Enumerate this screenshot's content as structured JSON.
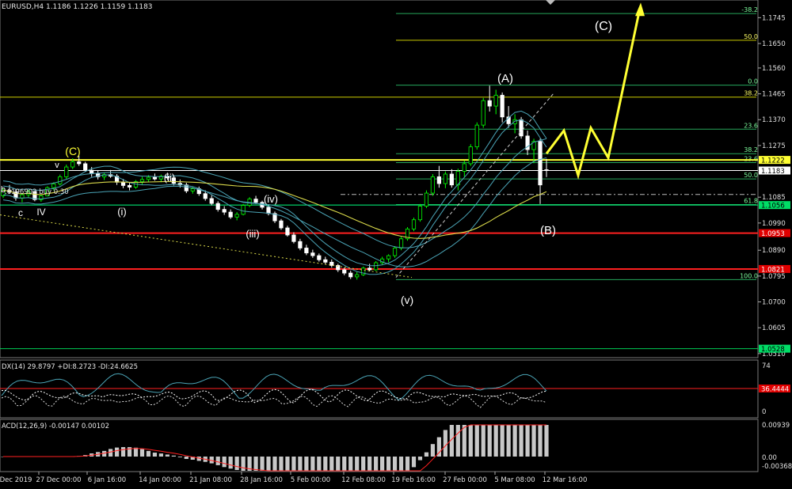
{
  "chart_data": {
    "type": "candlestick",
    "symbol_header": "EURUSD,H4  1.1186 1.1226 1.1159 1.1183",
    "price_axis": {
      "ylim": [
        1.0495,
        1.181
      ],
      "ticks": [
        "1.1745",
        "1.1650",
        "1.1560",
        "1.1465",
        "1.1370",
        "1.1275",
        "1.1085",
        "1.0990",
        "1.0890",
        "1.0795",
        "1.0700",
        "1.0605",
        "1.0510"
      ]
    },
    "time_axis": {
      "labels": [
        "Dec 2019",
        "27 Dec 00:00",
        "6 Jan 16:00",
        "14 Jan 00:00",
        "21 Jan 08:00",
        "28 Jan 16:00",
        "5 Feb 00:00",
        "12 Feb 08:00",
        "19 Feb 16:00",
        "27 Feb 00:00",
        "5 Mar 08:00",
        "12 Mar 16:00"
      ]
    },
    "candles": [
      [
        1.109,
        1.1118,
        1.1082,
        1.111
      ],
      [
        1.111,
        1.113,
        1.1098,
        1.1104
      ],
      [
        1.1104,
        1.1115,
        1.1072,
        1.1082
      ],
      [
        1.1082,
        1.11,
        1.1066,
        1.1094
      ],
      [
        1.1094,
        1.1112,
        1.1085,
        1.1106
      ],
      [
        1.1106,
        1.1108,
        1.107,
        1.1076
      ],
      [
        1.1076,
        1.1095,
        1.1068,
        1.109
      ],
      [
        1.109,
        1.1125,
        1.1088,
        1.112
      ],
      [
        1.112,
        1.114,
        1.111,
        1.1134
      ],
      [
        1.1134,
        1.1168,
        1.1128,
        1.116
      ],
      [
        1.116,
        1.1205,
        1.1152,
        1.1196
      ],
      [
        1.1196,
        1.1228,
        1.1188,
        1.1215
      ],
      [
        1.1215,
        1.1238,
        1.12,
        1.1208
      ],
      [
        1.1208,
        1.1215,
        1.1178,
        1.1184
      ],
      [
        1.1184,
        1.1196,
        1.116,
        1.1172
      ],
      [
        1.1172,
        1.1182,
        1.115,
        1.116
      ],
      [
        1.116,
        1.1176,
        1.1148,
        1.1168
      ],
      [
        1.1168,
        1.1185,
        1.1156,
        1.1162
      ],
      [
        1.1162,
        1.117,
        1.113,
        1.114
      ],
      [
        1.114,
        1.1152,
        1.1118,
        1.1128
      ],
      [
        1.1128,
        1.114,
        1.111,
        1.1122
      ],
      [
        1.1122,
        1.1148,
        1.1116,
        1.1142
      ],
      [
        1.1142,
        1.116,
        1.1132,
        1.115
      ],
      [
        1.115,
        1.1166,
        1.114,
        1.1158
      ],
      [
        1.1158,
        1.1172,
        1.1146,
        1.1152
      ],
      [
        1.1152,
        1.1168,
        1.114,
        1.1162
      ],
      [
        1.1162,
        1.1175,
        1.1148,
        1.1156
      ],
      [
        1.1156,
        1.1162,
        1.1128,
        1.1136
      ],
      [
        1.1136,
        1.115,
        1.112,
        1.113
      ],
      [
        1.113,
        1.1138,
        1.11,
        1.1108
      ],
      [
        1.1108,
        1.1122,
        1.1098,
        1.1116
      ],
      [
        1.1116,
        1.1124,
        1.109,
        1.1098
      ],
      [
        1.1098,
        1.111,
        1.1072,
        1.108
      ],
      [
        1.108,
        1.1092,
        1.1055,
        1.1062
      ],
      [
        1.1062,
        1.107,
        1.1032,
        1.104
      ],
      [
        1.104,
        1.1052,
        1.102,
        1.103
      ],
      [
        1.103,
        1.104,
        1.1005,
        1.1012
      ],
      [
        1.1012,
        1.103,
        1.1,
        1.1022
      ],
      [
        1.1022,
        1.106,
        1.1018,
        1.1055
      ],
      [
        1.1055,
        1.1085,
        1.1048,
        1.1078
      ],
      [
        1.1078,
        1.109,
        1.106,
        1.1066
      ],
      [
        1.1066,
        1.1072,
        1.104,
        1.1048
      ],
      [
        1.1048,
        1.1056,
        1.1018,
        1.1025
      ],
      [
        1.1025,
        1.1032,
        1.099,
        1.0998
      ],
      [
        1.0998,
        1.1005,
        1.0965,
        1.0972
      ],
      [
        1.0972,
        1.098,
        1.094,
        1.0946
      ],
      [
        1.0946,
        1.0956,
        1.0915,
        1.0922
      ],
      [
        1.0922,
        1.0932,
        1.089,
        1.0898
      ],
      [
        1.0898,
        1.091,
        1.0872,
        1.088
      ],
      [
        1.088,
        1.0892,
        1.0862,
        1.087
      ],
      [
        1.087,
        1.0878,
        1.0848,
        1.0855
      ],
      [
        1.0855,
        1.0866,
        1.0838,
        1.0846
      ],
      [
        1.0846,
        1.0856,
        1.0826,
        1.0834
      ],
      [
        1.0834,
        1.084,
        1.081,
        1.0818
      ],
      [
        1.0818,
        1.0826,
        1.0798,
        1.0806
      ],
      [
        1.0806,
        1.0815,
        1.0784,
        1.0792
      ],
      [
        1.0792,
        1.081,
        1.0782,
        1.08
      ],
      [
        1.08,
        1.083,
        1.0795,
        1.0824
      ],
      [
        1.0824,
        1.084,
        1.0812,
        1.0818
      ],
      [
        1.0818,
        1.085,
        1.0814,
        1.0844
      ],
      [
        1.0844,
        1.0866,
        1.0836,
        1.0858
      ],
      [
        1.0858,
        1.0875,
        1.0846,
        1.087
      ],
      [
        1.087,
        1.0905,
        1.0862,
        1.0898
      ],
      [
        1.0898,
        1.094,
        1.089,
        1.0932
      ],
      [
        1.0932,
        1.0975,
        1.0925,
        1.0968
      ],
      [
        1.0968,
        1.101,
        1.096,
        1.1002
      ],
      [
        1.1002,
        1.106,
        1.0995,
        1.1052
      ],
      [
        1.1052,
        1.111,
        1.1045,
        1.11
      ],
      [
        1.11,
        1.117,
        1.109,
        1.116
      ],
      [
        1.116,
        1.12,
        1.112,
        1.1135
      ],
      [
        1.1135,
        1.118,
        1.1118,
        1.117
      ],
      [
        1.117,
        1.1188,
        1.112,
        1.113
      ],
      [
        1.113,
        1.119,
        1.111,
        1.118
      ],
      [
        1.118,
        1.122,
        1.116,
        1.1208
      ],
      [
        1.1208,
        1.128,
        1.12,
        1.127
      ],
      [
        1.127,
        1.136,
        1.126,
        1.135
      ],
      [
        1.135,
        1.145,
        1.134,
        1.144
      ],
      [
        1.144,
        1.1495,
        1.14,
        1.142
      ],
      [
        1.142,
        1.148,
        1.139,
        1.146
      ],
      [
        1.146,
        1.147,
        1.136,
        1.138
      ],
      [
        1.138,
        1.142,
        1.134,
        1.1355
      ],
      [
        1.1355,
        1.139,
        1.132,
        1.137
      ],
      [
        1.137,
        1.138,
        1.13,
        1.131
      ],
      [
        1.131,
        1.133,
        1.124,
        1.126
      ],
      [
        1.126,
        1.13,
        1.121,
        1.129
      ],
      [
        1.129,
        1.13,
        1.106,
        1.113
      ],
      [
        1.1186,
        1.1226,
        1.1159,
        1.1183
      ]
    ],
    "fib_levels": [
      {
        "label": "-38.2",
        "price": 1.176
      },
      {
        "label": "50.0",
        "price": 1.1662
      },
      {
        "label": "0.0",
        "price": 1.1497
      },
      {
        "label": "38.2",
        "price": 1.1453
      },
      {
        "label": "23.6",
        "price": 1.1335
      },
      {
        "label": "38.2",
        "price": 1.1245
      },
      {
        "label": "23.6",
        "price": 1.1212
      },
      {
        "label": "50.0",
        "price": 1.1152
      },
      {
        "label": "61.8",
        "price": 1.1058
      },
      {
        "label": "100.0",
        "price": 1.0782
      }
    ],
    "price_lines": [
      {
        "label": "1.1222",
        "price": 1.1222,
        "color": "#ffff33",
        "badge": "yellow"
      },
      {
        "label": "1.1183",
        "price": 1.1183,
        "color": "#ffffff",
        "badge": "white"
      },
      {
        "label": "1.1056",
        "price": 1.1056,
        "color": "#00ff7f",
        "badge": "green"
      },
      {
        "label": "1.0953",
        "price": 1.0953,
        "color": "#ff2020",
        "badge": "red"
      },
      {
        "label": "1.0821",
        "price": 1.0821,
        "color": "#ff2020",
        "badge": "red"
      },
      {
        "label": "1.0528",
        "price": 1.0528,
        "color": "#00cc55",
        "badge": "green"
      }
    ],
    "wave_labels": [
      {
        "text": "(C)",
        "color": "#ffff33"
      },
      {
        "text": "v",
        "color": "#ffffff"
      },
      {
        "text": "c",
        "color": "#ffffff"
      },
      {
        "text": "IV",
        "color": "#ffffff"
      },
      {
        "text": "(i)",
        "color": "#ffffff"
      },
      {
        "text": "(ii)",
        "color": "#ffffff"
      },
      {
        "text": "(iii)",
        "color": "#ffffff"
      },
      {
        "text": "(iv)",
        "color": "#ffffff"
      },
      {
        "text": "(v)",
        "color": "#ffffff"
      },
      {
        "text": "(A)",
        "color": "#ffffff"
      },
      {
        "text": "(B)",
        "color": "#ffffff"
      },
      {
        "text": "(C)",
        "color": "#ffffff"
      },
      {
        "text": "b",
        "color": "#ffffff"
      }
    ],
    "side_note": ".6196902 buy 0.30",
    "projection_color": "#ffff33",
    "adx": {
      "title": "DX(14) 29.8797 +DI:8.2723 -DI:24.6625",
      "ticks": [
        "74",
        "0"
      ],
      "level_label": "36.4444"
    },
    "macd": {
      "title": "ACD(12,26,9) -0.00147 0.00102",
      "ticks": [
        "0.00939",
        "0.00",
        "-0.00368"
      ]
    },
    "colors": {
      "bull": "#00ff00",
      "bear": "#ffffff",
      "grid": "#5a5a5a",
      "fib": "#26a65b",
      "fib_alt": "#c8c800",
      "band": "#4aa3b5",
      "ma": "#d9d94a"
    }
  }
}
